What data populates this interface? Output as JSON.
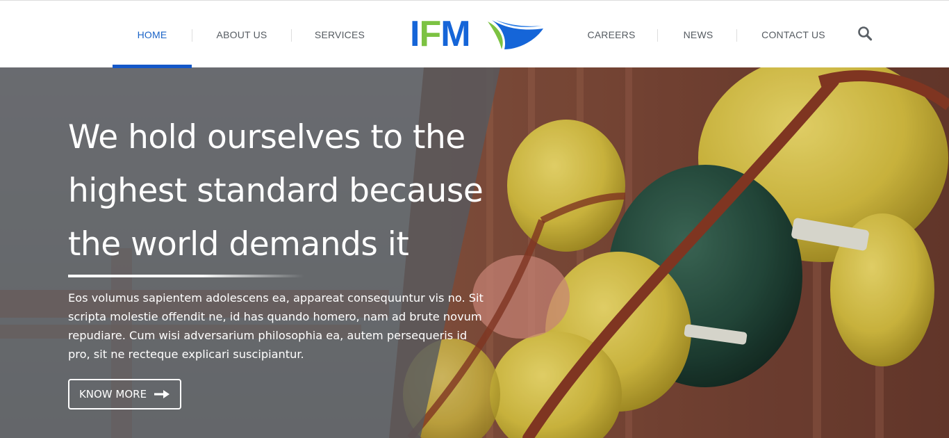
{
  "nav": {
    "left": [
      {
        "label": "HOME",
        "active": true
      },
      {
        "label": "ABOUT US",
        "active": false
      },
      {
        "label": "SERVICES",
        "active": false
      }
    ],
    "right": [
      {
        "label": "CAREERS",
        "active": false
      },
      {
        "label": "NEWS",
        "active": false
      },
      {
        "label": "CONTACT US",
        "active": false
      }
    ],
    "search_icon": "search-icon"
  },
  "logo": {
    "letters": [
      "I",
      "F",
      "M"
    ],
    "colors": {
      "blue": "#1565d8",
      "green": "#7cc242"
    }
  },
  "hero": {
    "headline": "We hold ourselves to the highest standard because the world demands it",
    "body": "Eos volumus sapientem adolescens ea, appareat consequuntur vis no. Sit scripta molestie offendit ne, id has quando homero, nam ad brute novum repudiare. Cum wisi adversarium philosophia ea, autem persequeris id pro, sit ne recteque explicari suscipiantur.",
    "cta_label": "KNOW MORE",
    "cta_icon": "arrow-right-icon"
  },
  "colors": {
    "accent": "#1458c9",
    "nav_text": "#555b61",
    "nav_active": "#1a63c7"
  }
}
